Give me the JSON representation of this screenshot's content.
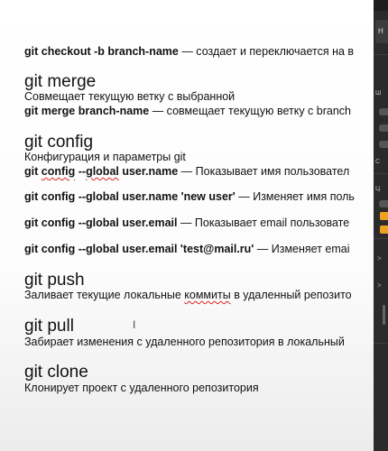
{
  "document": {
    "line_checkout": {
      "cmd": "git checkout -b branch-name",
      "desc": " — создает и переключается на в"
    },
    "merge": {
      "heading": "git merge",
      "desc": "Совмещает текущую ветку с выбранной",
      "cmd": "git merge branch-name",
      "cmd_desc": " — совмещает текущую ветку с branch"
    },
    "config": {
      "heading": "git config",
      "desc": "Конфигурация и параметры git",
      "items": [
        {
          "cmd_a": "git ",
          "cmd_b": "config",
          "cmd_c": " --",
          "cmd_d": "global",
          "cmd_e": " user.name",
          "desc": " — Показывает имя пользовател"
        },
        {
          "cmd": "git config --global user.name 'new user'",
          "desc": " — Изменяет имя поль"
        },
        {
          "cmd": "git config --global user.email",
          "desc": " — Показывает email пользовате"
        },
        {
          "cmd": "git config --global user.email 'test@mail.ru'",
          "desc": " — Изменяет emai"
        }
      ]
    },
    "push": {
      "heading": "git push",
      "desc_a": "Заливает текущие локальные ",
      "desc_b": "коммиты",
      "desc_c": " в удаленный репозито"
    },
    "pull": {
      "heading": "git pull",
      "desc": "Забирает изменения с удаленного репозитория в локальный"
    },
    "clone": {
      "heading": "git clone",
      "desc": "Клонирует проект с удаленного репозитория"
    }
  },
  "panel": {
    "tab_label": "H",
    "label_1": "Ш",
    "label_2": "С",
    "label_3": "Ц",
    "chevrons": [
      ">",
      ">"
    ]
  },
  "colors": {
    "spell_underline": "#d22",
    "panel_bg": "#2b2b2b",
    "accent": "#f0a020"
  }
}
